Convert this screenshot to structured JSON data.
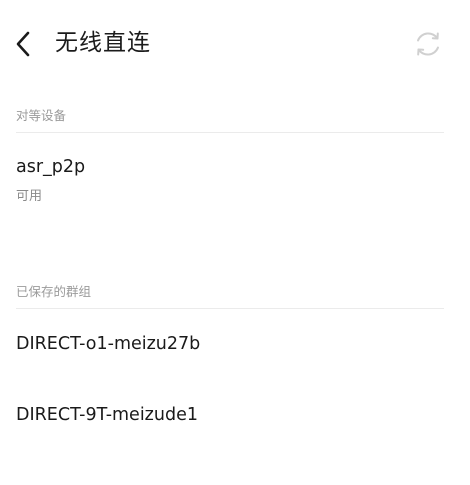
{
  "header": {
    "title": "无线直连",
    "back_icon": "chevron-left-icon",
    "refresh_icon": "refresh-icon"
  },
  "peers_section": {
    "label": "对等设备",
    "items": [
      {
        "name": "asr_p2p",
        "status": "可用"
      }
    ]
  },
  "saved_section": {
    "label": "已保存的群组",
    "items": [
      {
        "name": "DIRECT-o1-meizu27b"
      },
      {
        "name": "DIRECT-9T-meizude1"
      }
    ]
  },
  "colors": {
    "text_primary": "#1a1a1a",
    "text_secondary": "#9a9a9a",
    "divider": "#ebebeb",
    "icon_disabled": "#d0d0d0"
  }
}
